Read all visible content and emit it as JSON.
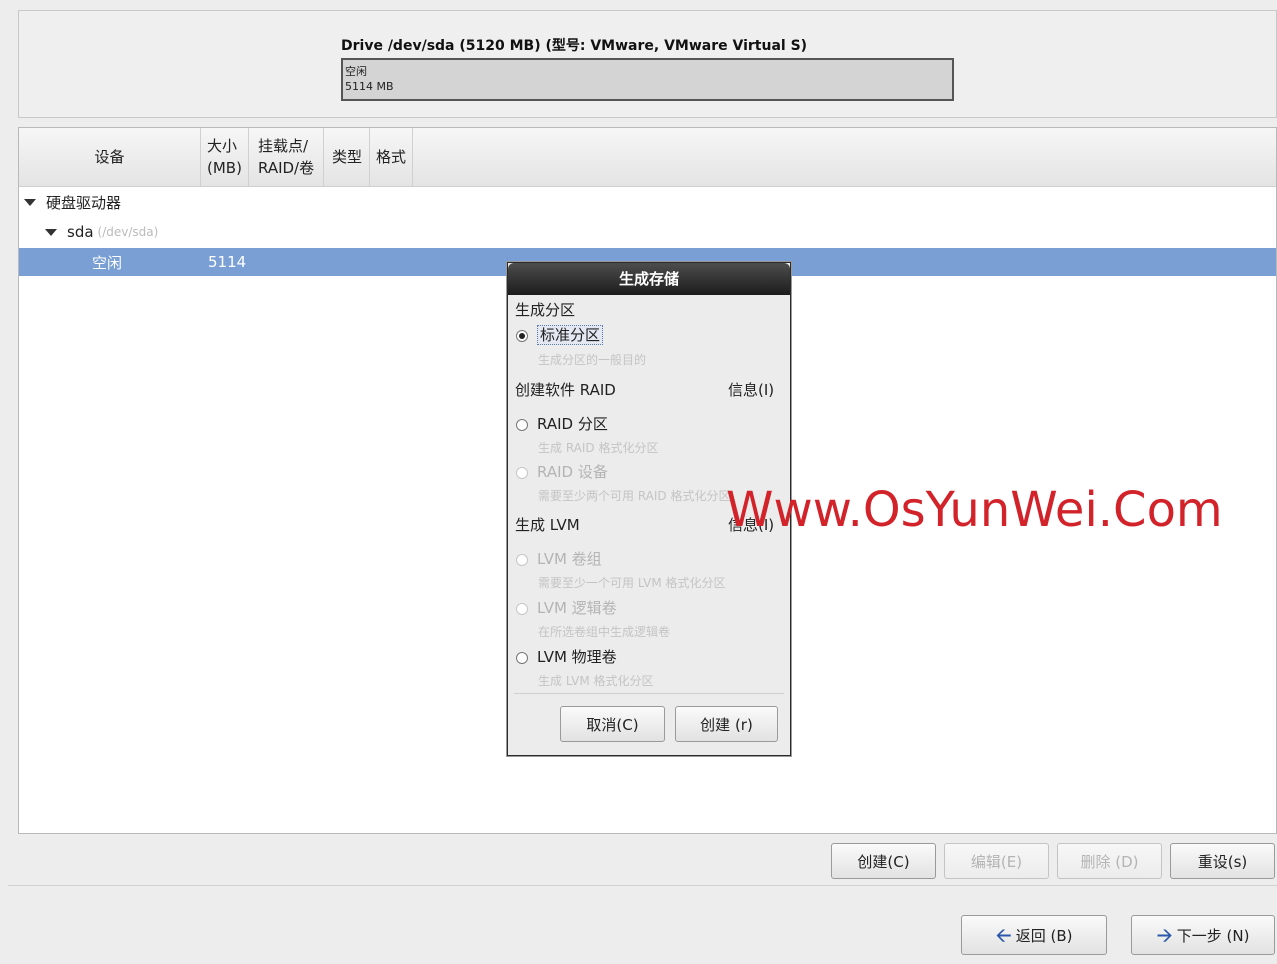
{
  "drive": {
    "title": "Drive /dev/sda (5120 MB) (型号: VMware, VMware Virtual S)",
    "bar_line1": "空闲",
    "bar_line2": "5114 MB"
  },
  "table": {
    "columns": {
      "device": "设备",
      "size_line1": "大小",
      "size_line2": "(MB)",
      "mount_line1": "挂载点/",
      "mount_line2": "RAID/卷",
      "type": "类型",
      "format": "格式"
    },
    "group": "硬盘驱动器",
    "disk_name": "sda",
    "disk_path": "(/dev/sda)",
    "free_row": {
      "device": "空闲",
      "size": "5114"
    }
  },
  "dialog": {
    "title": "生成存储",
    "section_partition": "生成分区",
    "opt_standard": "标准分区",
    "desc_standard": "生成分区的一般目的",
    "section_raid": "创建软件 RAID",
    "raid_info": "信息(I)",
    "opt_raid_partition": "RAID 分区",
    "desc_raid_partition": "生成 RAID 格式化分区",
    "opt_raid_device": "RAID 设备",
    "desc_raid_device": "需要至少两个可用 RAID 格式化分区",
    "section_lvm": "生成 LVM",
    "lvm_info": "信息(I)",
    "opt_lvm_vg": "LVM 卷组",
    "desc_lvm_vg": "需要至少一个可用 LVM 格式化分区",
    "opt_lvm_lv": "LVM 逻辑卷",
    "desc_lvm_lv": "在所选卷组中生成逻辑卷",
    "opt_lvm_pv": "LVM 物理卷",
    "desc_lvm_pv": "生成 LVM 格式化分区",
    "cancel": "取消(C)",
    "create": "创建 (r)"
  },
  "actions": {
    "create": "创建(C)",
    "edit": "编辑(E)",
    "delete": "删除 (D)",
    "reset": "重设(s)"
  },
  "nav": {
    "back": "返回 (B)",
    "next": "下一步 (N)"
  },
  "watermark": "Www.OsYunWei.Com",
  "colors": {
    "selection": "#7a9fd4",
    "watermark": "#d2232a",
    "nav_arrow": "#2b58a8"
  }
}
